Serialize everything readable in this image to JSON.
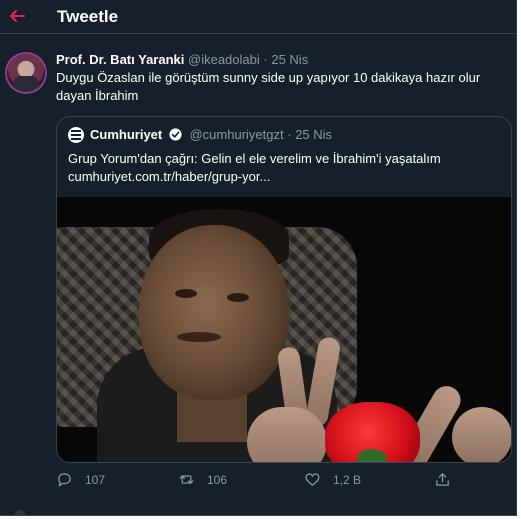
{
  "header": {
    "title": "Tweetle"
  },
  "tweet": {
    "author_name": "Prof. Dr. Batı Yaranki",
    "handle": "@ikeadolabi",
    "separator": "·",
    "date": "25 Nis",
    "text": "Duygu Özaslan ile görüştüm sunny side up yapıyor 10 dakikaya hazır olur dayan İbrahim"
  },
  "quote": {
    "name": "Cumhuriyet",
    "handle": "@cumhuriyetgzt",
    "separator": "·",
    "date": "25 Nis",
    "text": "Grup Yorum'dan çağrı: Gelin el ele verelim ve İbrahim'i yaşatalım",
    "link": "cumhuriyet.com.tr/haber/grup-yor..."
  },
  "actions": {
    "reply_count": "107",
    "retweet_count": "106",
    "like_count": "1,2 B"
  },
  "icons": {
    "back": "back-arrow-icon",
    "verified": "verified-badge-icon",
    "reply": "reply-icon",
    "retweet": "retweet-icon",
    "like": "heart-icon",
    "share": "share-icon"
  },
  "colors": {
    "background": "#15202b",
    "accent": "#e0245e",
    "muted": "#8899a6",
    "border": "#38444d",
    "verified": "#1da1f2"
  }
}
